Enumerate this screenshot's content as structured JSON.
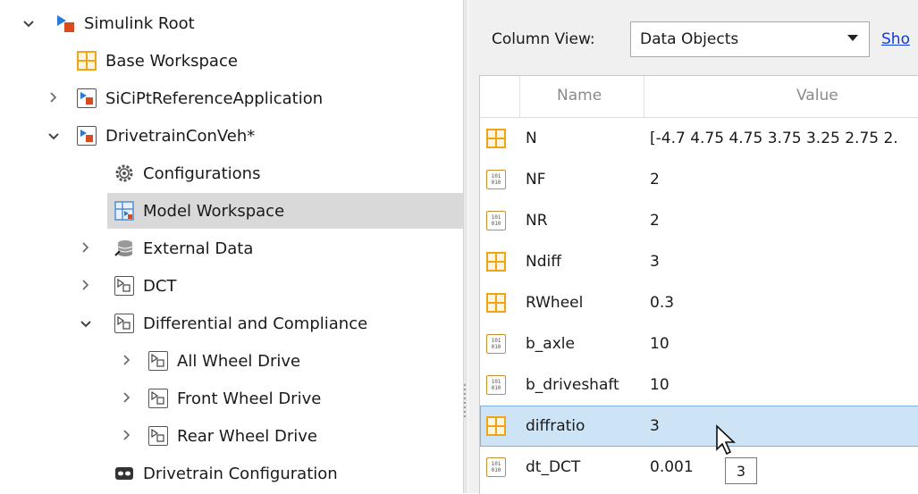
{
  "tree": {
    "root": "Simulink Root",
    "base_workspace": "Base Workspace",
    "sicipt": "SiCiPtReferenceApplication",
    "drivetrain": "DrivetrainConVeh*",
    "configurations": "Configurations",
    "model_workspace": "Model Workspace",
    "external_data": "External Data",
    "dct": "DCT",
    "diff_compliance": "Differential and Compliance",
    "all_wheel": "All Wheel Drive",
    "front_wheel": "Front Wheel Drive",
    "rear_wheel": "Rear Wheel Drive",
    "drivetrain_config": "Drivetrain Configuration"
  },
  "column_view": {
    "label": "Column View:",
    "selected": "Data Objects",
    "show_link": "Sho"
  },
  "table": {
    "headers": {
      "name": "Name",
      "value": "Value"
    },
    "rows": [
      {
        "name": "N",
        "value": "[-4.7 4.75 4.75 3.75 3.25 2.75 2.",
        "icon": "grid"
      },
      {
        "name": "NF",
        "value": "2",
        "icon": "vector"
      },
      {
        "name": "NR",
        "value": "2",
        "icon": "vector"
      },
      {
        "name": "Ndiff",
        "value": "3",
        "icon": "grid"
      },
      {
        "name": "RWheel",
        "value": "0.3",
        "icon": "grid"
      },
      {
        "name": "b_axle",
        "value": "10",
        "icon": "vector"
      },
      {
        "name": "b_driveshaft",
        "value": "10",
        "icon": "vector"
      },
      {
        "name": "diffratio",
        "value": "3",
        "icon": "grid",
        "selected": true
      },
      {
        "name": "dt_DCT",
        "value": "0.001",
        "icon": "vector"
      }
    ]
  },
  "tooltip": {
    "text": "3"
  },
  "icons": {
    "grid_variable": "grid-icon",
    "vector_variable": "binary-vector-icon",
    "model": "model-icon",
    "block": "subsystem-block-icon",
    "gear": "gear-icon",
    "database": "database-icon",
    "mask": "mask-icon"
  },
  "colors": {
    "selection_row": "#cde4f7",
    "tree_selection": "#d9d9d9",
    "grid_icon": "#f0a418",
    "link": "#0b3bdb"
  }
}
